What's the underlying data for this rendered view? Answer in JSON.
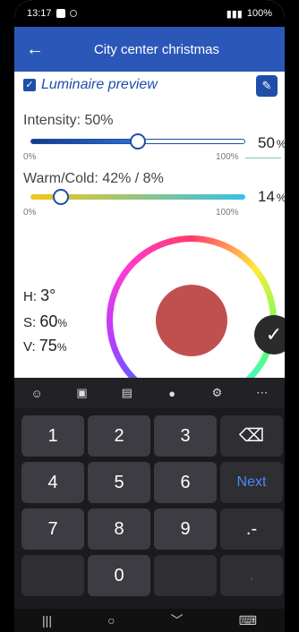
{
  "status_bar": {
    "time": "13:17",
    "battery": "100%"
  },
  "app_bar": {
    "back_icon": "arrow-left-icon",
    "title": "City center christmas"
  },
  "preview": {
    "checked": true,
    "label": "Luminaire preview",
    "edit_icon": "pencil-icon"
  },
  "intensity": {
    "label": "Intensity: 50%",
    "min_label": "0%",
    "max_label": "100%",
    "value": "50",
    "unit": "%",
    "level": 0.5
  },
  "warm_cold": {
    "label": "Warm/Cold: 42% / 8%",
    "min_label": "0%",
    "max_label": "100%",
    "value": "14",
    "unit": "%",
    "level": 0.14
  },
  "hsv": {
    "h_label": "H:",
    "h_value": "3°",
    "s_label": "S:",
    "s_value": "60",
    "s_unit": "%",
    "v_label": "V:",
    "v_value": "75",
    "v_unit": "%"
  },
  "color": {
    "swatch": "#c05050",
    "accent": "#2b58b8"
  },
  "confirm_icon": "checkmark-icon",
  "keyboard_toolbar": [
    "emoji-icon",
    "clipboard-icon",
    "notes-icon",
    "microphone-icon",
    "settings-icon",
    "more-icon"
  ],
  "keys": {
    "row1": [
      "1",
      "2",
      "3",
      "⌫"
    ],
    "row2": [
      "4",
      "5",
      "6",
      "Next"
    ],
    "row3": [
      "7",
      "8",
      "9",
      ".-"
    ],
    "row4": [
      "",
      "0",
      "",
      ","
    ]
  },
  "nav": [
    "recent-apps-icon",
    "home-icon",
    "back-icon",
    "keyboard-icon"
  ]
}
